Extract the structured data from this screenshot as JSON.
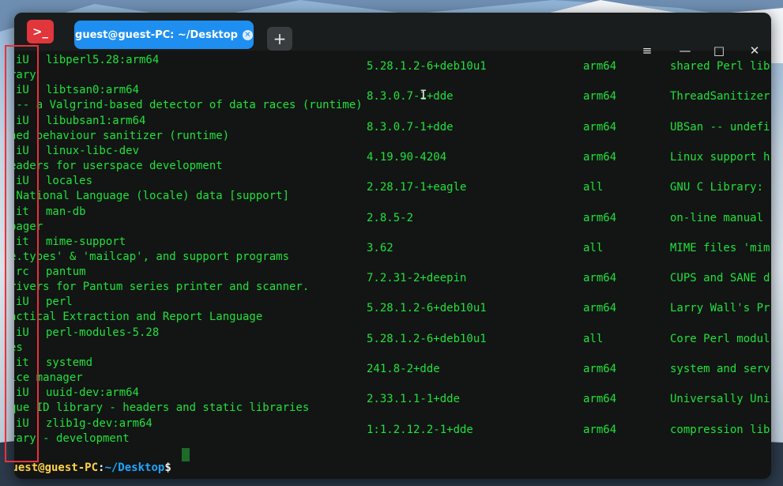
{
  "window": {
    "tab_title": "guest@guest-PC: ~/Desktop",
    "tab_close_glyph": "✕",
    "add_tab_glyph": "+",
    "app_icon_glyph": ">_",
    "menu_glyph": "≡",
    "minimize_glyph": "—",
    "maximize_glyph": "□",
    "close_glyph": "✕"
  },
  "rows": [
    {
      "status": "iU",
      "name": "libperl5.28:arm64",
      "version": "5.28.1.2-6+deb10u1",
      "arch": "arm64",
      "desc": "shared Perl lib",
      "cont": "rary"
    },
    {
      "status": "iU",
      "name": "libtsan0:arm64",
      "version": "8.3.0.7-1+dde",
      "arch": "arm64",
      "desc": "ThreadSanitizer",
      "cont": " -- a Valgrind-based detector of data races (runtime)"
    },
    {
      "status": "iU",
      "name": "libubsan1:arm64",
      "version": "8.3.0.7-1+dde",
      "arch": "arm64",
      "desc": "UBSan -- undefi",
      "cont": "ned behaviour sanitizer (runtime)"
    },
    {
      "status": "iU",
      "name": "linux-libc-dev",
      "version": "4.19.90-4204",
      "arch": "arm64",
      "desc": "Linux support h",
      "cont": "eaders for userspace development"
    },
    {
      "status": "iU",
      "name": "locales",
      "version": "2.28.17-1+eagle",
      "arch": "all",
      "desc": "GNU C Library:",
      "cont": " National Language (locale) data [support]"
    },
    {
      "status": "it",
      "name": "man-db",
      "version": "2.8.5-2",
      "arch": "arm64",
      "desc": "on-line manual",
      "cont": "pager"
    },
    {
      "status": "it",
      "name": "mime-support",
      "version": "3.62",
      "arch": "all",
      "desc": "MIME files 'mim",
      "cont": "e.types' & 'mailcap', and support programs"
    },
    {
      "status": "rc",
      "name": "pantum",
      "version": "7.2.31-2+deepin",
      "arch": "arm64",
      "desc": "CUPS and SANE d",
      "cont": "rivers for Pantum series printer and scanner."
    },
    {
      "status": "iU",
      "name": "perl",
      "version": "5.28.1.2-6+deb10u1",
      "arch": "arm64",
      "desc": "Larry Wall's Pr",
      "cont": "actical Extraction and Report Language"
    },
    {
      "status": "iU",
      "name": "perl-modules-5.28",
      "version": "5.28.1.2-6+deb10u1",
      "arch": "all",
      "desc": "Core Perl modul",
      "cont": "es"
    },
    {
      "status": "it",
      "name": "systemd",
      "version": "241.8-2+dde",
      "arch": "arm64",
      "desc": "system and serv",
      "cont": "ice manager"
    },
    {
      "status": "iU",
      "name": "uuid-dev:arm64",
      "version": "2.33.1.1-1+dde",
      "arch": "arm64",
      "desc": "Universally Uni",
      "cont": "que ID library - headers and static libraries"
    },
    {
      "status": "iU",
      "name": "zlib1g-dev:arm64",
      "version": "1:1.2.12.2-1+dde",
      "arch": "arm64",
      "desc": "compression lib",
      "cont": "rary - development"
    }
  ],
  "prompt": {
    "user": "guest@guest-PC",
    "sep": ":",
    "path": "~/Desktop",
    "symbol": "$"
  },
  "colors": {
    "terminal_text": "#22e03c",
    "prompt_user": "#ffd24a",
    "prompt_path": "#1ea5ff",
    "tab_accent": "#1e8ff0",
    "highlight": "#e8323c"
  }
}
